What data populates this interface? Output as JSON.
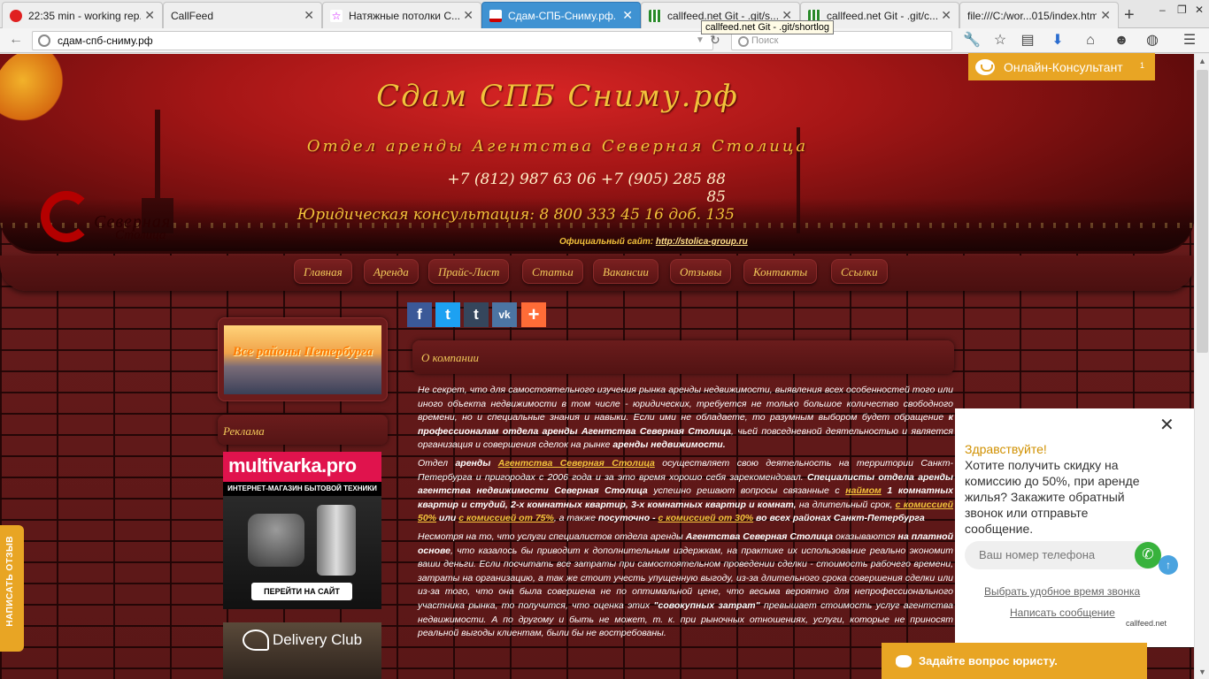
{
  "browser": {
    "tabs": [
      {
        "label": "22:35 min - working rep...",
        "active": false
      },
      {
        "label": "CallFeed",
        "active": false
      },
      {
        "label": "Натяжные потолки С...",
        "active": false
      },
      {
        "label": "Сдам-СПБ-Сниму.рф. ...",
        "active": true
      },
      {
        "label": "callfeed.net Git - .git/s...",
        "active": false
      },
      {
        "label": "callfeed.net Git - .git/c...",
        "active": false
      },
      {
        "label": "file:///C:/wor...015/index.html",
        "active": false
      }
    ],
    "url": "сдам-спб-сниму.рф",
    "search_placeholder": "Поиск",
    "tooltip": "callfeed.net Git - .git/shortlog"
  },
  "header": {
    "title": "Сдам СПБ Сниму.рф",
    "subtitle": "Отдел аренды Агентства Северная Столица",
    "phones": "+7 (812) 987 63 06    +7 (905) 285 88 85",
    "legal": "Юридическая консультация: 8 800 333 45 16 доб. 135",
    "site_label": "Официальный сайт:",
    "site_url": "http://stolica-group.ru",
    "logo_line1": "Северная",
    "logo_line2": "Столица"
  },
  "menu": [
    "Главная",
    "Аренда",
    "Прайс-Лист",
    "Статьи",
    "Вакансии",
    "Отзывы",
    "Контакты",
    "Ссылки"
  ],
  "social": [
    "f",
    "t",
    "t",
    "vk",
    "+"
  ],
  "sidebar": {
    "districts_banner": "Все районы Петербурга",
    "ad_heading": "Реклама",
    "ad1_brand": "multivarka.pro",
    "ad1_sub": "ИНТЕРНЕТ-МАГАЗИН БЫТОВОЙ ТЕХНИКИ",
    "ad1_button": "ПЕРЕЙТИ НА САЙТ",
    "ad2_brand": "Delivery Club"
  },
  "content": {
    "heading": "О компании",
    "p1_a": "Не секрет, что для самостоятельного изучения  рынка аренды недвижимости, выявления всех особенностей того или иного объекта недвижимости в том числе - юридических,  требуется не только большое количество свободного времени, но и специальные знания и навыки. Если ими не обладаете, то разумным выбором будет обращение ",
    "p1_b": "к профессионалам отдела аренды Агентства Северная Столица",
    "p1_c": ", чьей повседневной деятельностью и является организация и совершения сделок на рынке ",
    "p1_d": "аренды недвижимости.",
    "p2_a": "Отдел ",
    "p2_b": "аренды",
    "p2_link": "Агентства Северная Столица",
    "p2_c": "  осуществляет свою деятельность на территории Санкт-Петербурга и пригородах с 2006 года и за это время хорошо себя зарекомендовал. ",
    "p2_d": "Специалисты отдела аренды агентства недвижимости Северная Столица",
    "p2_e": " успешно решают вопросы связанные  с  ",
    "p2_link2": "наймом",
    "p2_f": " 1 комнатных квартир и студий, 2-х комнатных квартир, 3-х комнатных квартир и комнат,",
    "p2_g": "  на длительный срок, ",
    "p2_link3": "с комиссией 50%",
    "p2_h": " или ",
    "p2_link4": "с комиссией от 75%",
    "p2_i": ", а также ",
    "p2_j": "посуточно - ",
    "p2_link5": "с комиссией от 30%",
    "p2_k": " во всех районах Санкт-Петербурга",
    "p3_a": "Несмотря на то, что  услуги специалистов отдела аренды ",
    "p3_b": "Агентства Северная Столица",
    "p3_c": "  оказываются ",
    "p3_d": "на платной основе",
    "p3_e": ", что казалось бы приводит к дополнительным издержкам, на практике их использование реально экономит ваши деньги. Если посчитать все затраты при самостоятельном проведении сделки - стоимость рабочего времени,  затраты на организацию,  а так же  стоит учесть упущенную выгоду, из-за длительного срока совершения сделки или из-за того, что она была совершена не по оптимальной цене, что весьма вероятно для непрофессионального участника рынка, то получится, что оценка этих ",
    "p3_f": "\"совокупных затрат\"",
    "p3_g": " превышает стоимость услуг агентства недвижимости. А по другому и быть не может, т. к. при рыночных отношениях, услуги, которые не приносят реальной выгоды клиентам, были бы не востребованы."
  },
  "widget": {
    "online_label": "Онлайн-Консультант",
    "online_count": "1",
    "close": "✕",
    "hello": "Здравствуйте!",
    "text": "Хотите получить скидку на комиссию до 50%, при аренде жилья? Закажите обратный звонок или отправьте сообщение.",
    "phone_placeholder": "Ваш номер телефона",
    "link_time": "Выбрать удобное время звонка",
    "link_message": "Написать сообщение",
    "brand": "callfeed.net",
    "lawyer": "Задайте вопрос юристу.",
    "review": "НАПИСАТЬ ОТЗЫВ"
  },
  "colors": {
    "accent": "#e8a524",
    "gold_text": "#f2c23b",
    "active_tab": "#3f92d2"
  }
}
